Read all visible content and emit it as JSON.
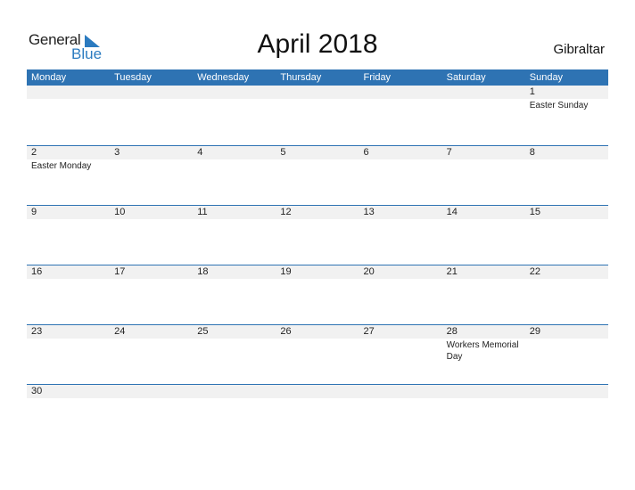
{
  "logo": {
    "line1": "General",
    "line2": "Blue",
    "accent": "#2b7bc0"
  },
  "header": {
    "title": "April 2018",
    "country": "Gibraltar"
  },
  "colors": {
    "header_bg": "#2e73b3",
    "band_bg": "#f1f1f1"
  },
  "weekdays": [
    "Monday",
    "Tuesday",
    "Wednesday",
    "Thursday",
    "Friday",
    "Saturday",
    "Sunday"
  ],
  "weeks": [
    [
      {
        "d": ""
      },
      {
        "d": ""
      },
      {
        "d": ""
      },
      {
        "d": ""
      },
      {
        "d": ""
      },
      {
        "d": ""
      },
      {
        "d": "1",
        "h": "Easter Sunday"
      }
    ],
    [
      {
        "d": "2",
        "h": "Easter Monday"
      },
      {
        "d": "3"
      },
      {
        "d": "4"
      },
      {
        "d": "5"
      },
      {
        "d": "6"
      },
      {
        "d": "7"
      },
      {
        "d": "8"
      }
    ],
    [
      {
        "d": "9"
      },
      {
        "d": "10"
      },
      {
        "d": "11"
      },
      {
        "d": "12"
      },
      {
        "d": "13"
      },
      {
        "d": "14"
      },
      {
        "d": "15"
      }
    ],
    [
      {
        "d": "16"
      },
      {
        "d": "17"
      },
      {
        "d": "18"
      },
      {
        "d": "19"
      },
      {
        "d": "20"
      },
      {
        "d": "21"
      },
      {
        "d": "22"
      }
    ],
    [
      {
        "d": "23"
      },
      {
        "d": "24"
      },
      {
        "d": "25"
      },
      {
        "d": "26"
      },
      {
        "d": "27"
      },
      {
        "d": "28",
        "h": "Workers Memorial Day"
      },
      {
        "d": "29"
      }
    ],
    [
      {
        "d": "30"
      },
      {
        "d": ""
      },
      {
        "d": ""
      },
      {
        "d": ""
      },
      {
        "d": ""
      },
      {
        "d": ""
      },
      {
        "d": ""
      }
    ]
  ]
}
